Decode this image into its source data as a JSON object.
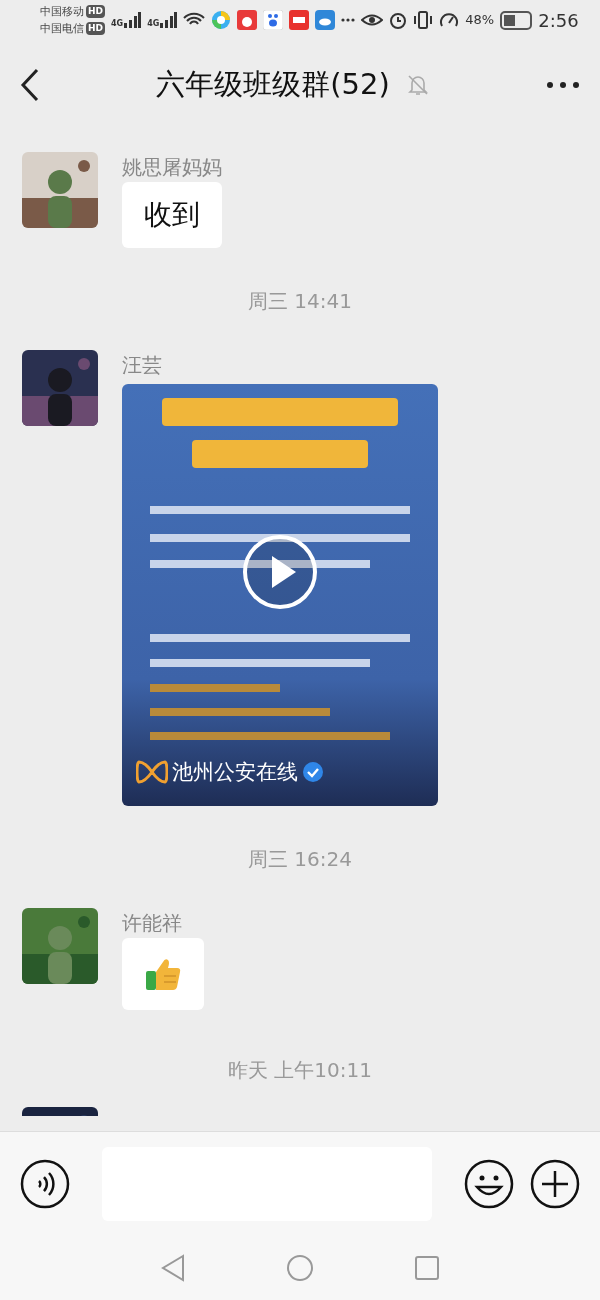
{
  "status_bar": {
    "carriers": [
      {
        "name": "中国移动",
        "badge": "HD"
      },
      {
        "name": "中国电信",
        "badge": "HD"
      }
    ],
    "networks": [
      "4G",
      "4G"
    ],
    "battery_text": "48%",
    "battery": {
      "level": 0.45
    },
    "time": "2:56"
  },
  "header": {
    "title": "六年级班级群(52)",
    "muted": true
  },
  "messages": [
    {
      "kind": "text",
      "sender": "姚思屠妈妈",
      "text": "收到"
    },
    {
      "kind": "timestamp",
      "text": "周三 14:41"
    },
    {
      "kind": "video",
      "sender": "汪芸",
      "account": "池州公安在线",
      "verified": true
    },
    {
      "kind": "timestamp",
      "text": "周三 16:24"
    },
    {
      "kind": "emoji",
      "sender": "许能祥"
    },
    {
      "kind": "timestamp",
      "text": "昨天 上午10:11"
    },
    {
      "kind": "partial"
    }
  ]
}
